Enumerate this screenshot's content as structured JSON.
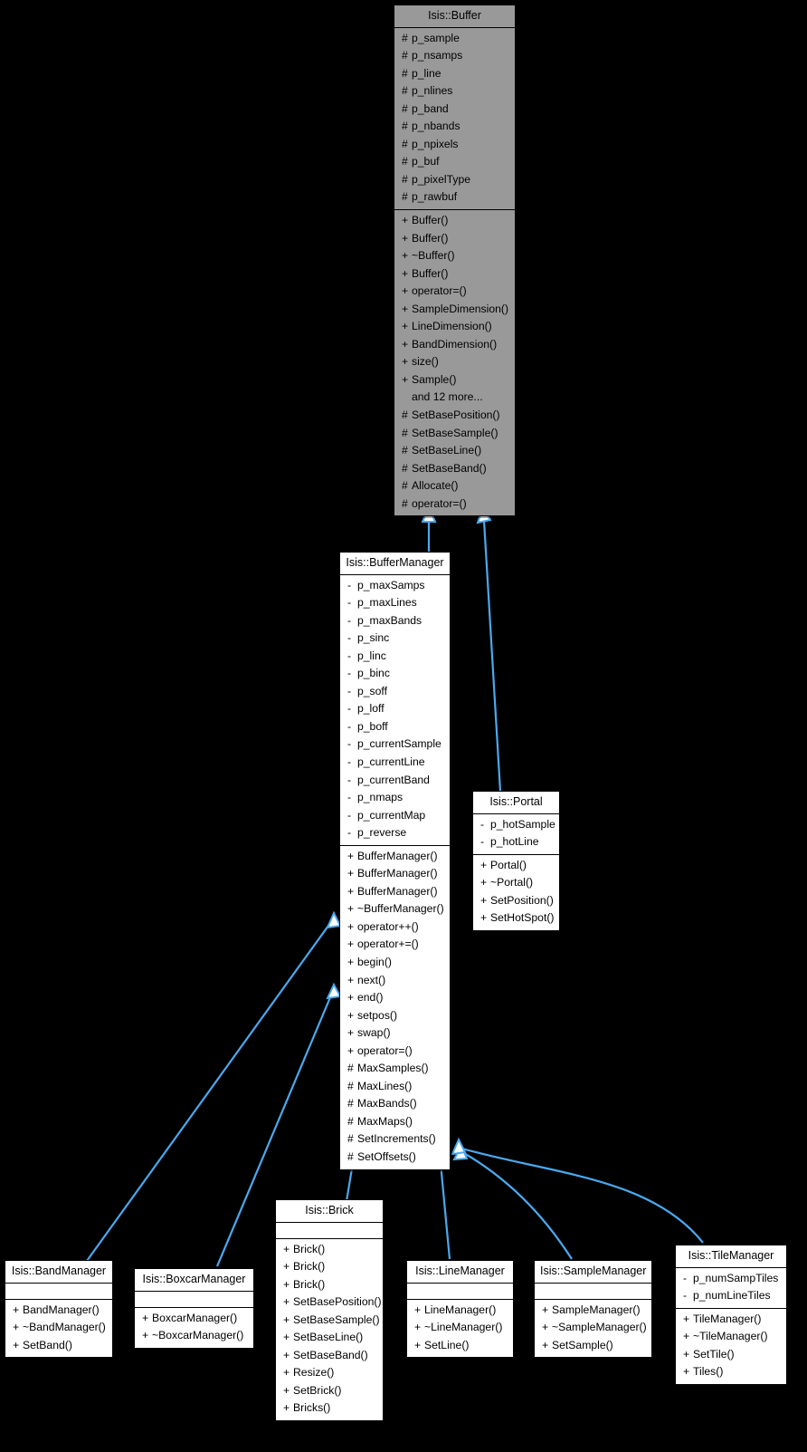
{
  "diagram": {
    "title": "Isis::Buffer inheritance diagram",
    "type": "uml-class-hierarchy",
    "background_color": "#000000",
    "node_fill": "#ffffff",
    "highlight_fill": "#999999",
    "edge_color": "#4aa9ef",
    "border_color": "#000000"
  },
  "nodes": [
    {
      "id": "buffer",
      "title": "Isis::Buffer",
      "highlight": true,
      "attributes": [
        {
          "vis": "#",
          "name": "p_sample"
        },
        {
          "vis": "#",
          "name": "p_nsamps"
        },
        {
          "vis": "#",
          "name": "p_line"
        },
        {
          "vis": "#",
          "name": "p_nlines"
        },
        {
          "vis": "#",
          "name": "p_band"
        },
        {
          "vis": "#",
          "name": "p_nbands"
        },
        {
          "vis": "#",
          "name": "p_npixels"
        },
        {
          "vis": "#",
          "name": "p_buf"
        },
        {
          "vis": "#",
          "name": "p_pixelType"
        },
        {
          "vis": "#",
          "name": "p_rawbuf"
        }
      ],
      "operations": [
        {
          "vis": "+",
          "name": "Buffer()"
        },
        {
          "vis": "+",
          "name": "Buffer()"
        },
        {
          "vis": "+",
          "name": "~Buffer()"
        },
        {
          "vis": "+",
          "name": "Buffer()"
        },
        {
          "vis": "+",
          "name": "operator=()"
        },
        {
          "vis": "+",
          "name": "SampleDimension()"
        },
        {
          "vis": "+",
          "name": "LineDimension()"
        },
        {
          "vis": "+",
          "name": "BandDimension()"
        },
        {
          "vis": "+",
          "name": "size()"
        },
        {
          "vis": "+",
          "name": "Sample()"
        },
        {
          "vis": "",
          "name": "and 12 more...",
          "note": true
        },
        {
          "vis": "#",
          "name": "SetBasePosition()"
        },
        {
          "vis": "#",
          "name": "SetBaseSample()"
        },
        {
          "vis": "#",
          "name": "SetBaseLine()"
        },
        {
          "vis": "#",
          "name": "SetBaseBand()"
        },
        {
          "vis": "#",
          "name": "Allocate()"
        },
        {
          "vis": "#",
          "name": "operator=()"
        }
      ]
    },
    {
      "id": "buffermanager",
      "title": "Isis::BufferManager",
      "highlight": false,
      "attributes": [
        {
          "vis": "-",
          "name": "p_maxSamps"
        },
        {
          "vis": "-",
          "name": "p_maxLines"
        },
        {
          "vis": "-",
          "name": "p_maxBands"
        },
        {
          "vis": "-",
          "name": "p_sinc"
        },
        {
          "vis": "-",
          "name": "p_linc"
        },
        {
          "vis": "-",
          "name": "p_binc"
        },
        {
          "vis": "-",
          "name": "p_soff"
        },
        {
          "vis": "-",
          "name": "p_loff"
        },
        {
          "vis": "-",
          "name": "p_boff"
        },
        {
          "vis": "-",
          "name": "p_currentSample"
        },
        {
          "vis": "-",
          "name": "p_currentLine"
        },
        {
          "vis": "-",
          "name": "p_currentBand"
        },
        {
          "vis": "-",
          "name": "p_nmaps"
        },
        {
          "vis": "-",
          "name": "p_currentMap"
        },
        {
          "vis": "-",
          "name": "p_reverse"
        }
      ],
      "operations": [
        {
          "vis": "+",
          "name": "BufferManager()"
        },
        {
          "vis": "+",
          "name": "BufferManager()"
        },
        {
          "vis": "+",
          "name": "BufferManager()"
        },
        {
          "vis": "+",
          "name": "~BufferManager()"
        },
        {
          "vis": "+",
          "name": "operator++()"
        },
        {
          "vis": "+",
          "name": "operator+=()"
        },
        {
          "vis": "+",
          "name": "begin()"
        },
        {
          "vis": "+",
          "name": "next()"
        },
        {
          "vis": "+",
          "name": "end()"
        },
        {
          "vis": "+",
          "name": "setpos()"
        },
        {
          "vis": "+",
          "name": "swap()"
        },
        {
          "vis": "+",
          "name": "operator=()"
        },
        {
          "vis": "#",
          "name": "MaxSamples()"
        },
        {
          "vis": "#",
          "name": "MaxLines()"
        },
        {
          "vis": "#",
          "name": "MaxBands()"
        },
        {
          "vis": "#",
          "name": "MaxMaps()"
        },
        {
          "vis": "#",
          "name": "SetIncrements()"
        },
        {
          "vis": "#",
          "name": "SetOffsets()"
        }
      ]
    },
    {
      "id": "portal",
      "title": "Isis::Portal",
      "highlight": false,
      "attributes": [
        {
          "vis": "-",
          "name": "p_hotSample"
        },
        {
          "vis": "-",
          "name": "p_hotLine"
        }
      ],
      "operations": [
        {
          "vis": "+",
          "name": "Portal()"
        },
        {
          "vis": "+",
          "name": "~Portal()"
        },
        {
          "vis": "+",
          "name": "SetPosition()"
        },
        {
          "vis": "+",
          "name": "SetHotSpot()"
        }
      ]
    },
    {
      "id": "bandmanager",
      "title": "Isis::BandManager",
      "highlight": false,
      "attributes": [],
      "operations": [
        {
          "vis": "+",
          "name": "BandManager()"
        },
        {
          "vis": "+",
          "name": "~BandManager()"
        },
        {
          "vis": "+",
          "name": "SetBand()"
        }
      ]
    },
    {
      "id": "boxcarmanager",
      "title": "Isis::BoxcarManager",
      "highlight": false,
      "attributes": [],
      "operations": [
        {
          "vis": "+",
          "name": "BoxcarManager()"
        },
        {
          "vis": "+",
          "name": "~BoxcarManager()"
        }
      ]
    },
    {
      "id": "brick",
      "title": "Isis::Brick",
      "highlight": false,
      "attributes": [],
      "operations": [
        {
          "vis": "+",
          "name": "Brick()"
        },
        {
          "vis": "+",
          "name": "Brick()"
        },
        {
          "vis": "+",
          "name": "Brick()"
        },
        {
          "vis": "+",
          "name": "SetBasePosition()"
        },
        {
          "vis": "+",
          "name": "SetBaseSample()"
        },
        {
          "vis": "+",
          "name": "SetBaseLine()"
        },
        {
          "vis": "+",
          "name": "SetBaseBand()"
        },
        {
          "vis": "+",
          "name": "Resize()"
        },
        {
          "vis": "+",
          "name": "SetBrick()"
        },
        {
          "vis": "+",
          "name": "Bricks()"
        }
      ]
    },
    {
      "id": "linemanager",
      "title": "Isis::LineManager",
      "highlight": false,
      "attributes": [],
      "operations": [
        {
          "vis": "+",
          "name": "LineManager()"
        },
        {
          "vis": "+",
          "name": "~LineManager()"
        },
        {
          "vis": "+",
          "name": "SetLine()"
        }
      ]
    },
    {
      "id": "samplemanager",
      "title": "Isis::SampleManager",
      "highlight": false,
      "attributes": [],
      "operations": [
        {
          "vis": "+",
          "name": "SampleManager()"
        },
        {
          "vis": "+",
          "name": "~SampleManager()"
        },
        {
          "vis": "+",
          "name": "SetSample()"
        }
      ]
    },
    {
      "id": "tilemanager",
      "title": "Isis::TileManager",
      "highlight": false,
      "attributes": [
        {
          "vis": "-",
          "name": "p_numSampTiles"
        },
        {
          "vis": "-",
          "name": "p_numLineTiles"
        }
      ],
      "operations": [
        {
          "vis": "+",
          "name": "TileManager()"
        },
        {
          "vis": "+",
          "name": "~TileManager()"
        },
        {
          "vis": "+",
          "name": "SetTile()"
        },
        {
          "vis": "+",
          "name": "Tiles()"
        }
      ]
    }
  ],
  "edges": [
    {
      "from": "buffermanager",
      "to": "buffer",
      "kind": "inheritance"
    },
    {
      "from": "portal",
      "to": "buffer",
      "kind": "inheritance"
    },
    {
      "from": "bandmanager",
      "to": "buffermanager",
      "kind": "inheritance"
    },
    {
      "from": "boxcarmanager",
      "to": "buffermanager",
      "kind": "inheritance"
    },
    {
      "from": "brick",
      "to": "buffermanager",
      "kind": "inheritance"
    },
    {
      "from": "linemanager",
      "to": "buffermanager",
      "kind": "inheritance"
    },
    {
      "from": "samplemanager",
      "to": "buffermanager",
      "kind": "inheritance"
    },
    {
      "from": "tilemanager",
      "to": "buffermanager",
      "kind": "inheritance"
    }
  ]
}
